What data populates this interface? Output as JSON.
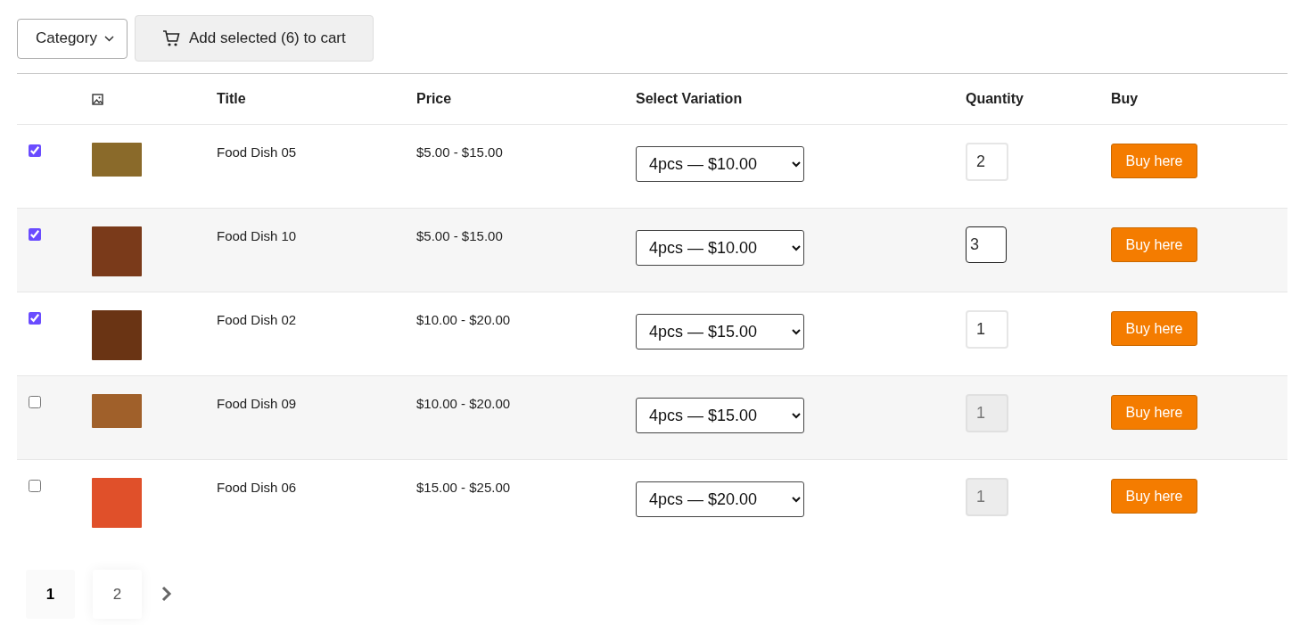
{
  "toolbar": {
    "category": {
      "label": "Category"
    },
    "add_to_cart": {
      "label": "Add selected (6) to cart"
    }
  },
  "table": {
    "columns": [
      "Title",
      "Price",
      "Select Variation",
      "Quantity",
      "Buy"
    ],
    "rows": [
      {
        "checked": true,
        "title": "Food Dish 05",
        "price": "$5.00 - $15.00",
        "variation": "4pcs — $10.00",
        "quantity": "2",
        "focused": false,
        "disabled": false,
        "buy": "Buy here"
      },
      {
        "checked": true,
        "title": "Food Dish 10",
        "price": "$5.00 - $15.00",
        "variation": "4pcs — $10.00",
        "quantity": "3",
        "focused": true,
        "disabled": false,
        "buy": "Buy here"
      },
      {
        "checked": true,
        "title": "Food Dish 02",
        "price": "$10.00 - $20.00",
        "variation": "4pcs — $15.00",
        "quantity": "1",
        "focused": false,
        "disabled": false,
        "buy": "Buy here"
      },
      {
        "checked": false,
        "title": "Food Dish 09",
        "price": "$10.00 - $20.00",
        "variation": "4pcs — $15.00",
        "quantity": "1",
        "focused": false,
        "disabled": true,
        "buy": "Buy here"
      },
      {
        "checked": false,
        "title": "Food Dish 06",
        "price": "$15.00 - $25.00",
        "variation": "4pcs — $20.00",
        "quantity": "1",
        "focused": false,
        "disabled": true,
        "buy": "Buy here"
      }
    ]
  },
  "pagination": {
    "pages": [
      {
        "label": "1",
        "selected": true
      },
      {
        "label": "2",
        "selected": false
      }
    ]
  }
}
